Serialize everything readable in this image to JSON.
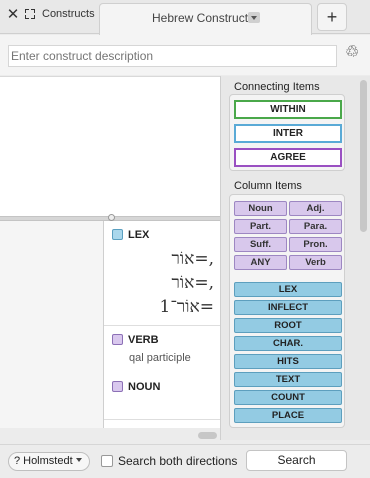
{
  "tabs": {
    "close_glyph": "✕",
    "constructs_label": "Constructs",
    "active_label": "Hebrew Construct",
    "add_glyph": "+"
  },
  "description": {
    "placeholder": "Enter construct description",
    "recycle_glyph": "♲"
  },
  "results": {
    "lex_header": "LEX",
    "hebrew_lines": [
      "אוֹר=,",
      "אוֹר=,",
      "אוֹר־1="
    ],
    "verb_header": "VERB",
    "verb_sub": "qal participle",
    "noun_header": "NOUN"
  },
  "palette": {
    "connecting_title": "Connecting Items",
    "connecting": [
      {
        "label": "WITHIN",
        "color": "#4aa84a"
      },
      {
        "label": "INTER",
        "color": "#5aaad6"
      },
      {
        "label": "AGREE",
        "color": "#9a50c2"
      }
    ],
    "column_title": "Column Items",
    "grammar": [
      "Noun",
      "Adj.",
      "Part.",
      "Para.",
      "Suff.",
      "Pron.",
      "ANY",
      "Verb"
    ],
    "items": [
      "LEX",
      "INFLECT",
      "ROOT",
      "CHAR.",
      "HITS",
      "TEXT",
      "COUNT",
      "PLACE"
    ]
  },
  "footer": {
    "help_glyph": "?",
    "version": "Holmstedt",
    "checkbox_label": "Search both directions",
    "search_label": "Search"
  },
  "colors": {
    "grammar_fill": "#d8c8ec",
    "item_fill": "#93cbe3"
  }
}
